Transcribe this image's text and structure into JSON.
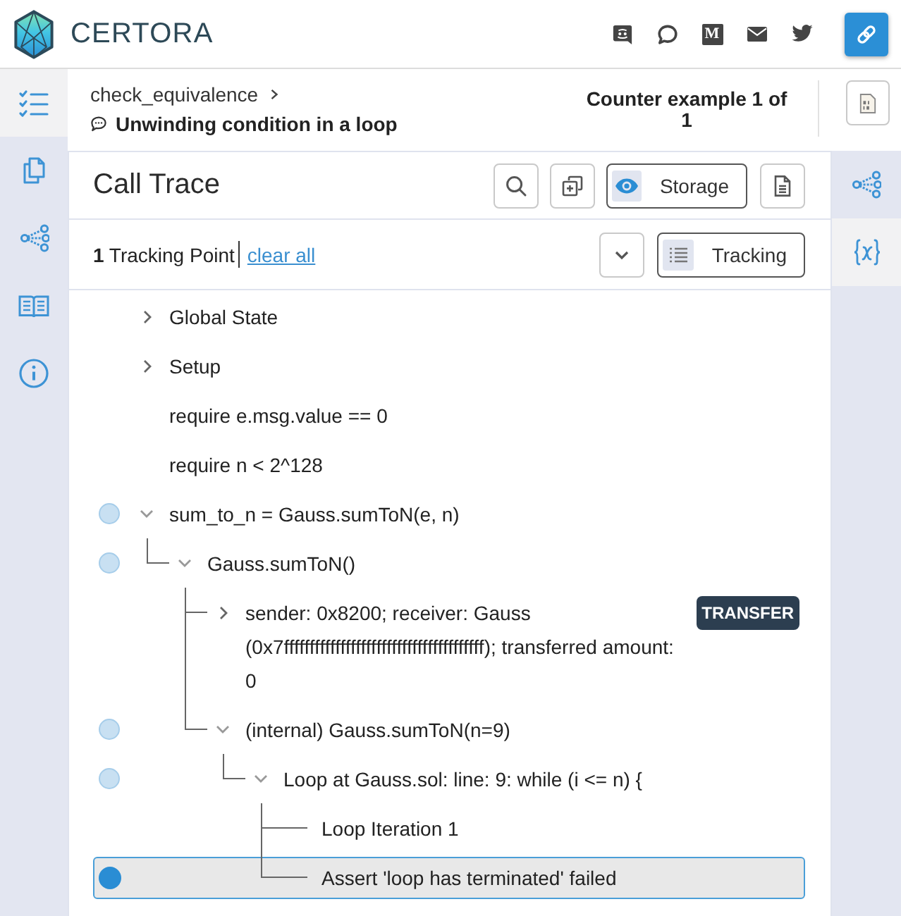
{
  "header": {
    "brand": "CERTORA",
    "social": [
      {
        "kind": "face-bubble"
      },
      {
        "kind": "round-bubble"
      },
      {
        "kind": "letter",
        "label": "M"
      },
      {
        "kind": "envelope"
      },
      {
        "kind": "bird"
      }
    ]
  },
  "left_sidebar": {
    "items": [
      {
        "selected": true
      },
      {
        "selected": false
      },
      {
        "selected": false
      },
      {
        "selected": false
      },
      {
        "selected": false
      }
    ]
  },
  "breadcrumb": {
    "rule": "check_equivalence",
    "subtitle": "Unwinding condition in a loop",
    "counter": "Counter example 1 of 1"
  },
  "call_trace": {
    "title": "Call Trace",
    "storage_button": "Storage",
    "tracking_count": "**1** Tracking Point",
    "clear_link": "clear all",
    "tracking_button": "Tracking",
    "rows": [
      {
        "label": "Global State",
        "expanded": false,
        "selected": false
      },
      {
        "label": "Setup",
        "expanded": false,
        "selected": false
      },
      {
        "label": "require e.msg.value == 0",
        "selected": false
      },
      {
        "label": "require n < 2^128",
        "selected": false
      },
      {
        "label": "sum_to_n = Gauss.sumToN(e, n)",
        "expanded": true,
        "tracked": false,
        "selected": false,
        "children": [
          {
            "label": "Gauss.sumToN()",
            "expanded": true,
            "tracked": false,
            "selected": false,
            "children": [
              {
                "label": "sender: 0x8200; receiver: Gauss (0x7fffffffffffffffffffffffffffffffffffffff); transferred amount: 0",
                "expanded": false,
                "badge": "TRANSFER",
                "selected": false
              },
              {
                "label": "(internal) Gauss.sumToN(n=9)",
                "expanded": true,
                "tracked": false,
                "selected": false,
                "children": [
                  {
                    "label": "Loop at Gauss.sol: line: 9: while (i <= n) {",
                    "expanded": true,
                    "tracked": false,
                    "selected": false,
                    "children": [
                      {
                        "label": "Loop Iteration 1",
                        "selected": false
                      },
                      {
                        "label": "Assert 'loop has terminated' failed",
                        "tracked": true,
                        "selected": true
                      }
                    ]
                  }
                ]
              }
            ]
          }
        ]
      }
    ]
  },
  "right_sidebar": {
    "items": [
      {
        "selected": false
      },
      {
        "selected": true
      }
    ]
  }
}
